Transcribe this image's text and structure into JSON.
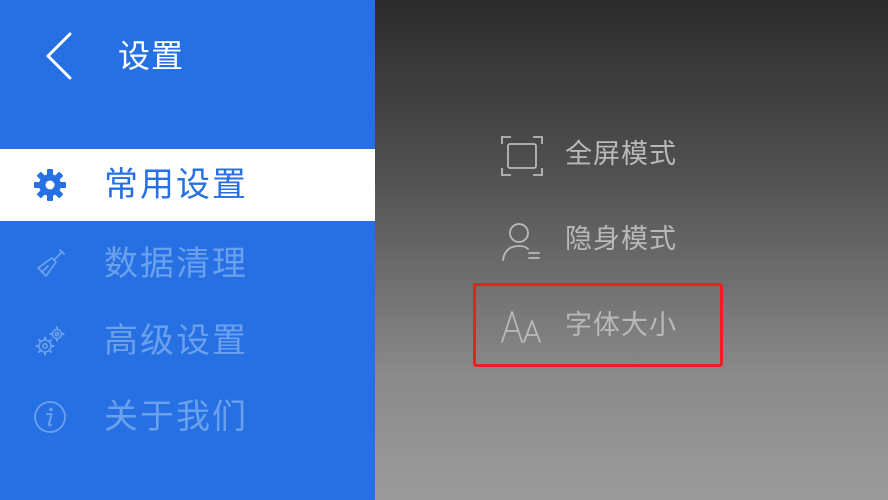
{
  "header": {
    "title": "设置",
    "back_icon": "chevron-left-icon"
  },
  "sidebar": {
    "items": [
      {
        "label": "常用设置",
        "icon": "gear-icon",
        "active": true
      },
      {
        "label": "数据清理",
        "icon": "broom-icon",
        "active": false
      },
      {
        "label": "高级设置",
        "icon": "gears-icon",
        "active": false
      },
      {
        "label": "关于我们",
        "icon": "info-icon",
        "active": false
      }
    ]
  },
  "panel": {
    "options": [
      {
        "label": "全屏模式",
        "icon": "fullscreen-icon"
      },
      {
        "label": "隐身模式",
        "icon": "incognito-user-icon"
      },
      {
        "label": "字体大小",
        "icon": "font-size-icon",
        "highlighted": true
      }
    ]
  },
  "colors": {
    "accent": "#2670e3",
    "inactive_text": "#6aa0ec",
    "highlight_border": "#e8201f",
    "option_text": "#b9b9b9"
  }
}
